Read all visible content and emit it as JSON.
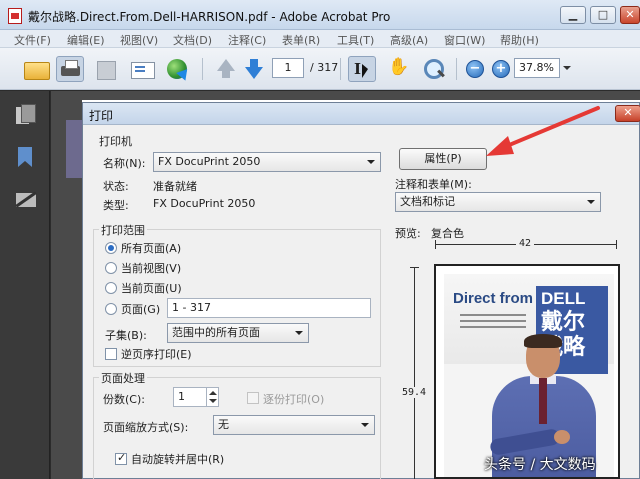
{
  "window": {
    "title": "戴尔战略.Direct.From.Dell-HARRISON.pdf - Adobe Acrobat Pro",
    "minimize_label": "▁",
    "maximize_label": "□",
    "close_label": "✕"
  },
  "menu": {
    "items": [
      "文件(F)",
      "编辑(E)",
      "视图(V)",
      "文档(D)",
      "注释(C)",
      "表单(R)",
      "工具(T)",
      "高级(A)",
      "窗口(W)",
      "帮助(H)"
    ]
  },
  "toolbar": {
    "page_current": "1",
    "page_total": "/ 317",
    "zoom_out_label": "−",
    "zoom_in_label": "+",
    "zoom_value": "37.8%"
  },
  "dialog": {
    "title": "打印",
    "close_label": "✕",
    "printer": {
      "group_label": "打印机",
      "name_label": "名称(N):",
      "name_value": "FX DocuPrint 2050",
      "status_label": "状态:",
      "status_value": "准备就绪",
      "type_label": "类型:",
      "type_value": "FX DocuPrint 2050",
      "properties_button": "属性(P)",
      "comments_label": "注释和表单(M):",
      "comments_value": "文档和标记"
    },
    "range": {
      "group_label": "打印范围",
      "options": [
        "所有页面(A)",
        "当前视图(V)",
        "当前页面(U)",
        "页面(G)"
      ],
      "selected_index": 0,
      "pages_value": "1 - 317",
      "subset_label": "子集(B):",
      "subset_value": "范围中的所有页面",
      "reverse_label": "逆页序打印(E)"
    },
    "handling": {
      "group_label": "页面处理",
      "copies_label": "份数(C):",
      "copies_value": "1",
      "collate_label": "逐份打印(O)",
      "scaling_label": "页面缩放方式(S):",
      "scaling_value": "无",
      "autorotate_label": "自动旋转并居中(R)"
    },
    "preview": {
      "label": "预览:",
      "color_mode": "复合色",
      "width": "42",
      "height": "59.4",
      "cover_title_en": "Direct from",
      "cover_brand": "DELL",
      "cover_title_cn": "戴尔战略"
    }
  },
  "watermark": "头条号 / 大文数码",
  "colors": {
    "annotation_arrow": "#e53935",
    "selected_radio": "#2b6cc4",
    "cover_blue": "#3a59a2"
  }
}
